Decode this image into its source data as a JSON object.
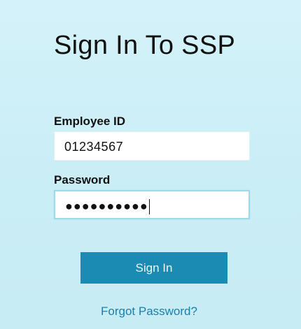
{
  "title": "Sign In To SSP",
  "employee_id": {
    "label": "Employee ID",
    "value": "01234567"
  },
  "password": {
    "label": "Password",
    "masked_value": "●●●●●●●●●●"
  },
  "signin_button": {
    "label": "Sign In"
  },
  "forgot_link": {
    "label": "Forgot Password?"
  },
  "colors": {
    "background": "#cdeef6",
    "button": "#1b8bb3",
    "link": "#1b7fa8"
  }
}
